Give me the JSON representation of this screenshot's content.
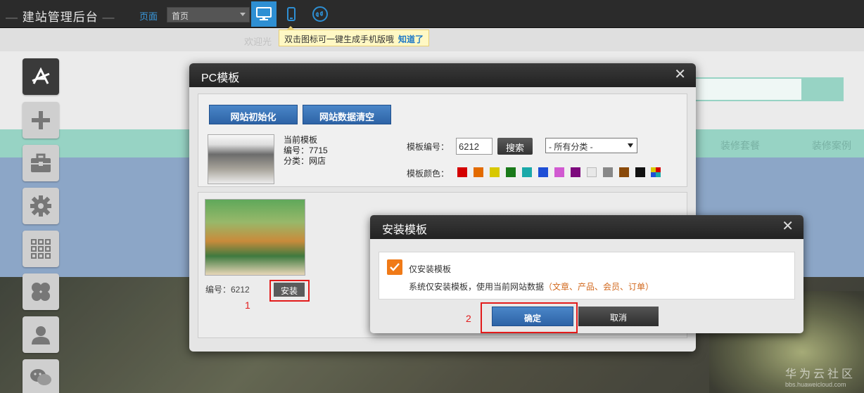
{
  "topbar": {
    "title": "建站管理后台",
    "page_label": "页面",
    "page_select_value": "首页",
    "tooltip_text": "双击图标可一键生成手机版哦",
    "tooltip_ok": "知道了"
  },
  "background": {
    "welcome": "欢迎光",
    "nav_items": [
      "装修套餐",
      "装修案例"
    ],
    "watermark": "华为云社区",
    "watermark_url": "bbs.huaweicloud.com"
  },
  "sidebar": {
    "items": [
      "apps-icon",
      "plus-icon",
      "toolbox-icon",
      "gear-icon",
      "grid-icon",
      "clover-icon",
      "user-icon",
      "wechat-icon"
    ]
  },
  "pc_modal": {
    "title": "PC模板",
    "init_button": "网站初始化",
    "clear_button": "网站数据清空",
    "current_template": {
      "heading": "当前模板",
      "number": "编号：7715",
      "category": "分类：网店"
    },
    "template_no_label": "模板编号：",
    "template_no_value": "6212",
    "search_button": "搜索",
    "category_select": "- 所有分类 -",
    "color_label": "模板颜色：",
    "colors": [
      "#d40000",
      "#e36b00",
      "#d8c800",
      "#1a7a1a",
      "#1aa9a9",
      "#1f4fd6",
      "#d15ad1",
      "#7d0a7d",
      "#e8e8e8",
      "#888888",
      "#8a4a0a",
      "#111111"
    ],
    "result": {
      "number": "编号：6212",
      "install_button": "安装"
    },
    "step1": "1"
  },
  "install_dialog": {
    "title": "安装模板",
    "option_label": "仅安装模板",
    "description": "系统仅安装模板，使用当前网站数据",
    "description_highlight": "（文章、产品、会员、订单）",
    "ok_button": "确定",
    "cancel_button": "取消",
    "step2": "2"
  }
}
